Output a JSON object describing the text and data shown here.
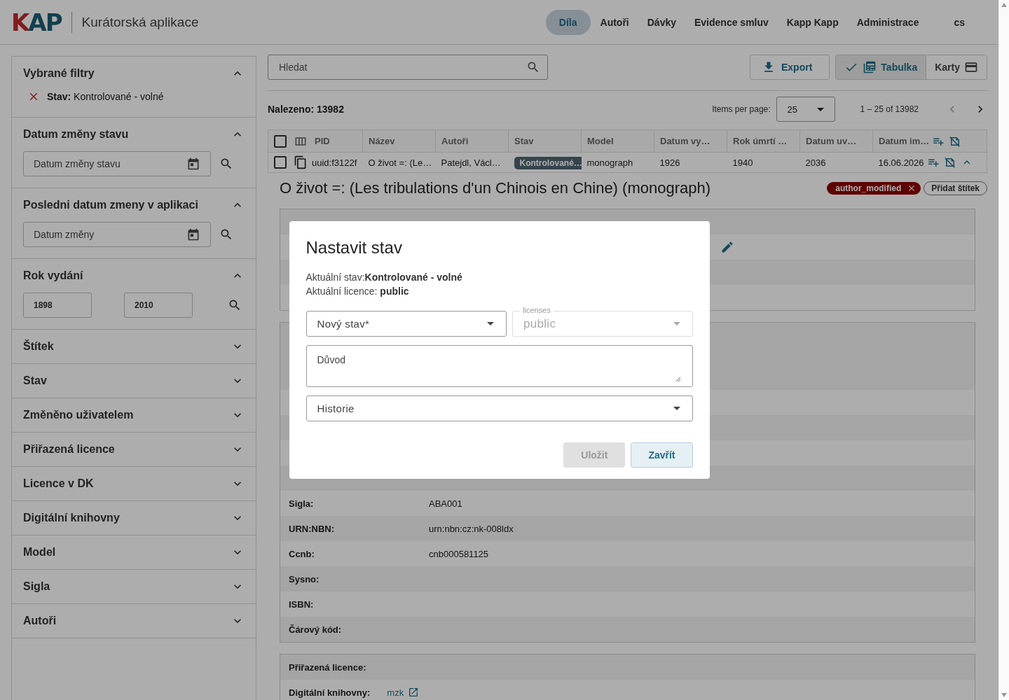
{
  "header": {
    "logo": "KAP",
    "app_title": "Kurátorská aplikace",
    "nav": [
      {
        "label": "Díla",
        "selected": true
      },
      {
        "label": "Autoři",
        "selected": false
      },
      {
        "label": "Dávky",
        "selected": false
      },
      {
        "label": "Evidence smluv",
        "selected": false
      },
      {
        "label": "Kapp Kapp",
        "selected": false
      },
      {
        "label": "Administrace",
        "selected": false
      }
    ],
    "language": "cs"
  },
  "sidebar": {
    "sections": [
      {
        "title": "Vybrané filtry",
        "expanded": true,
        "kind": "chips",
        "chips": [
          {
            "text": "**Stav:** Kontrolované - volné"
          }
        ]
      },
      {
        "title": "Datum změny stavu",
        "expanded": true,
        "kind": "date",
        "placeholder": "Datum změny stavu"
      },
      {
        "title": "Posledni datum zmeny v aplikaci",
        "expanded": true,
        "kind": "date",
        "placeholder": "Datum změny"
      },
      {
        "title": "Rok vydání",
        "expanded": true,
        "kind": "range",
        "from": "1898",
        "to": "2010"
      },
      {
        "title": "Štítek",
        "expanded": false
      },
      {
        "title": "Stav",
        "expanded": false
      },
      {
        "title": "Změněno uživatelem",
        "expanded": false
      },
      {
        "title": "Přiřazená licence",
        "expanded": false
      },
      {
        "title": "Licence v DK",
        "expanded": false
      },
      {
        "title": "Digitální knihovny",
        "expanded": false
      },
      {
        "title": "Model",
        "expanded": false
      },
      {
        "title": "Sigla",
        "expanded": false
      },
      {
        "title": "Autoři",
        "expanded": false
      }
    ]
  },
  "toolbar": {
    "search": {
      "placeholder": "Hledat"
    },
    "export": "Export",
    "views": [
      {
        "label": "Tabulka",
        "selected": true
      },
      {
        "label": "Karty",
        "selected": false
      }
    ]
  },
  "results": {
    "found": "Nalezeno: 13982",
    "items_per_page_label": "Items per page:",
    "items_per_page": "25",
    "range": "1 – 25 of 13982"
  },
  "table": {
    "header_checked": false,
    "columns": [
      "PID",
      "Název",
      "Autoři",
      "Stav",
      "Model",
      "Datum vy…",
      "Rok úmrtí …",
      "Datum uv…",
      "Datum im…"
    ],
    "rows": [
      {
        "checked": false,
        "expanded": true,
        "cells": [
          "uuid:f3122f",
          "O život =: (Le…",
          "Patejdl, Václ…",
          "Kontrolované…",
          "monograph",
          "1926",
          "1940",
          "2036",
          "16.06.2026"
        ]
      }
    ]
  },
  "detail": {
    "title": "O život =: (Les tribulations d'un Chinois en Chine) (monograph)",
    "tags": [
      {
        "label": "author_modified"
      }
    ],
    "add_tag": "Přidat štítek",
    "cards": [
      {
        "kind": "wide",
        "rows": [
          {
            "kind": "blank"
          },
          {
            "kind": "edit"
          },
          {
            "kind": "blank"
          },
          {
            "kind": "blank"
          }
        ]
      },
      {
        "kind": "wide",
        "rows": [
          {
            "kind": "tall"
          },
          {
            "kind": "blank"
          },
          {
            "kind": "blank"
          },
          {
            "kind": "blank"
          },
          {
            "kind": "blank"
          },
          {
            "kind": "text",
            "label": "Sigla:",
            "value": "ABA001"
          },
          {
            "kind": "text",
            "label": "URN:NBN:",
            "value": "urn:nbn:cz:nk-008ldx"
          },
          {
            "kind": "text",
            "label": "Ccnb:",
            "value": "cnb000581125"
          },
          {
            "kind": "label",
            "label": "Sysno:"
          },
          {
            "kind": "label",
            "label": "ISBN:"
          },
          {
            "kind": "label",
            "label": "Čárový kód:"
          }
        ]
      },
      {
        "kind": "compact",
        "rows": [
          {
            "kind": "label",
            "label": "Přiřazená licence:"
          },
          {
            "kind": "external",
            "label": "Digitální knihovny:",
            "value": "mzk"
          }
        ]
      }
    ]
  },
  "dialog": {
    "title": "Nastavit stav",
    "info": [
      "Aktuální stav:**Kontrolované - volné**",
      "Aktuální licence: **public**"
    ],
    "new_state": {
      "placeholder": "Nový stav*"
    },
    "license": {
      "label": "licenses",
      "value": "public",
      "disabled": true
    },
    "reason": {
      "placeholder": "Důvod"
    },
    "history": {
      "placeholder": "Historie"
    },
    "buttons": [
      {
        "label": "Uložit",
        "kind": "save",
        "disabled": true
      },
      {
        "label": "Zavřít",
        "kind": "close",
        "disabled": false
      }
    ]
  }
}
